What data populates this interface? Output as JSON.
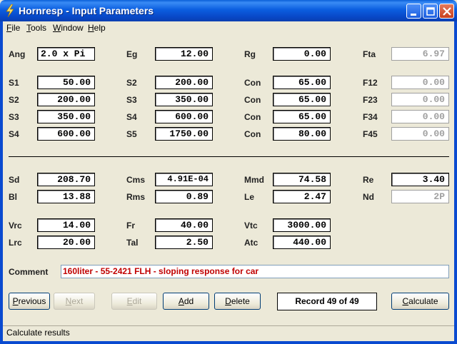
{
  "window": {
    "title": "Hornresp - Input Parameters"
  },
  "menu": {
    "file": {
      "u": "F",
      "rest": "ile"
    },
    "tools": {
      "u": "T",
      "rest": "ools"
    },
    "window": {
      "u": "W",
      "rest": "indow"
    },
    "help": {
      "u": "H",
      "rest": "elp"
    }
  },
  "fields": {
    "ang": {
      "label": "Ang",
      "value": "2.0 x Pi"
    },
    "eg": {
      "label": "Eg",
      "value": "12.00"
    },
    "rg": {
      "label": "Rg",
      "value": "0.00"
    },
    "fta": {
      "label": "Fta",
      "value": "6.97"
    },
    "s1a": {
      "label": "S1",
      "value": "50.00"
    },
    "s2b": {
      "label": "S2",
      "value": "200.00"
    },
    "con1": {
      "label": "Con",
      "value": "65.00"
    },
    "f12": {
      "label": "F12",
      "value": "0.00"
    },
    "s2a": {
      "label": "S2",
      "value": "200.00"
    },
    "s3b": {
      "label": "S3",
      "value": "350.00"
    },
    "con2": {
      "label": "Con",
      "value": "65.00"
    },
    "f23": {
      "label": "F23",
      "value": "0.00"
    },
    "s3a": {
      "label": "S3",
      "value": "350.00"
    },
    "s4b": {
      "label": "S4",
      "value": "600.00"
    },
    "con3": {
      "label": "Con",
      "value": "65.00"
    },
    "f34": {
      "label": "F34",
      "value": "0.00"
    },
    "s4a": {
      "label": "S4",
      "value": "600.00"
    },
    "s5b": {
      "label": "S5",
      "value": "1750.00"
    },
    "con4": {
      "label": "Con",
      "value": "80.00"
    },
    "f45": {
      "label": "F45",
      "value": "0.00"
    },
    "sd": {
      "label": "Sd",
      "value": "208.70"
    },
    "cms": {
      "label": "Cms",
      "value": "4.91E-04"
    },
    "mmd": {
      "label": "Mmd",
      "value": "74.58"
    },
    "re": {
      "label": "Re",
      "value": "3.40"
    },
    "bl": {
      "label": "Bl",
      "value": "13.88"
    },
    "rms": {
      "label": "Rms",
      "value": "0.89"
    },
    "le": {
      "label": "Le",
      "value": "2.47"
    },
    "nd": {
      "label": "Nd",
      "value": "2P"
    },
    "vrc": {
      "label": "Vrc",
      "value": "14.00"
    },
    "fr": {
      "label": "Fr",
      "value": "40.00"
    },
    "vtc": {
      "label": "Vtc",
      "value": "3000.00"
    },
    "lrc": {
      "label": "Lrc",
      "value": "20.00"
    },
    "tal": {
      "label": "Tal",
      "value": "2.50"
    },
    "atc": {
      "label": "Atc",
      "value": "440.00"
    }
  },
  "comment": {
    "label": "Comment",
    "value": "160liter - 55-2421 FLH - sloping response for car"
  },
  "buttons": {
    "previous": {
      "u": "P",
      "rest": "revious"
    },
    "next": {
      "u": "N",
      "rest": "ext"
    },
    "edit": {
      "u": "E",
      "rest": "dit"
    },
    "add": {
      "u": "A",
      "rest": "dd"
    },
    "delete": {
      "u": "D",
      "rest": "elete"
    },
    "calculate": {
      "u": "C",
      "rest": "alculate"
    }
  },
  "record": "Record 49 of 49",
  "status": "Calculate results",
  "colors": {
    "titlebar": "#0a5fd8",
    "comment_text": "#c00000",
    "dim_text": "#a0a0a0"
  }
}
